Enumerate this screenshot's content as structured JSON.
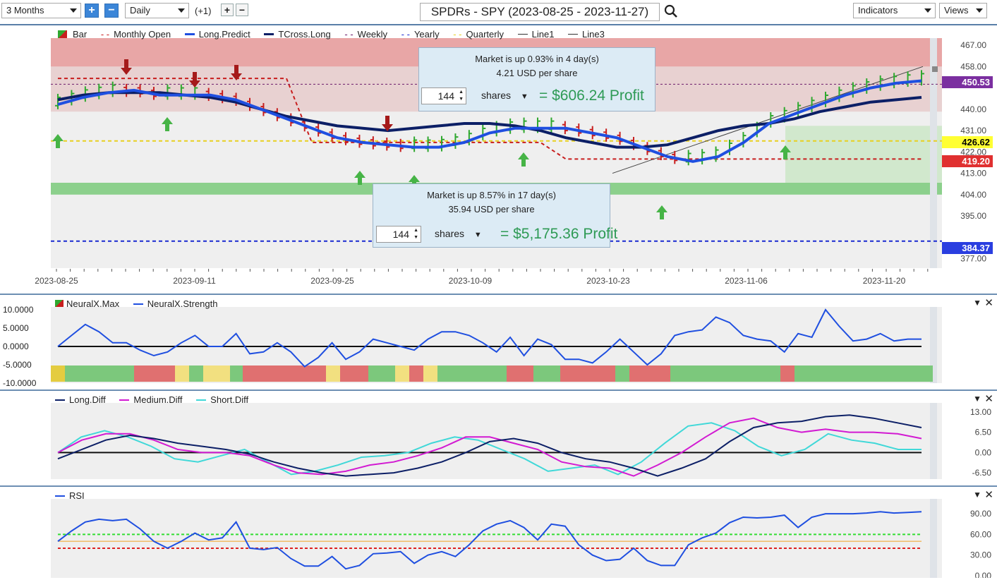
{
  "toolbar": {
    "period": "3 Months",
    "interval": "Daily",
    "offset": "(+1)",
    "title": "SPDRs - SPY (2023-08-25 - 2023-11-27)",
    "indicators": "Indicators",
    "views": "Views"
  },
  "legend_main": [
    "Bar",
    "Monthly Open",
    "Long.Predict",
    "TCross.Long",
    "Weekly",
    "Yearly",
    "Quarterly",
    "Line1",
    "Line3"
  ],
  "tooltip_top": {
    "line1": "Market is up 0.93% in 4 day(s)",
    "line2": "4.21 USD per share",
    "shares": "144",
    "shares_label": "shares",
    "profit": "= $606.24 Profit"
  },
  "tooltip_bottom": {
    "line1": "Market is up 8.57% in 17 day(s)",
    "line2": "35.94 USD per share",
    "shares": "144",
    "shares_label": "shares",
    "profit": "= $5,175.36 Profit"
  },
  "price_tags": {
    "t1": "450.53",
    "t2": "426.62",
    "t3": "419.20",
    "t4": "384.37"
  },
  "colors": {
    "up": "#2fa82f",
    "down": "#c81e1e",
    "long_predict": "#1f4fe0",
    "tcross": "#0c1f66",
    "tag_purple": "#7b2fa0",
    "tag_yellow": "#ffff33",
    "tag_red": "#e03030",
    "tag_blue": "#2a3ee0"
  },
  "chart_data": [
    {
      "type": "line",
      "title": "SPDRs - SPY (2023-08-25 - 2023-11-27)",
      "x_ticks": [
        "2023-08-25",
        "2023-09-11",
        "2023-09-25",
        "2023-10-09",
        "2023-10-23",
        "2023-11-06",
        "2023-11-20"
      ],
      "y_ticks": [
        467.0,
        458.0,
        440.0,
        431.0,
        422.0,
        413.0,
        404.0,
        395.0,
        377.0
      ],
      "ylim": [
        373,
        470
      ],
      "series": [
        {
          "name": "Long.Predict",
          "values": [
            442,
            445,
            447,
            448,
            446,
            446,
            446,
            444,
            440,
            436,
            432,
            428,
            426,
            425,
            424,
            424,
            426,
            430,
            432,
            432,
            432,
            430,
            428,
            424,
            420,
            418,
            420,
            426,
            434,
            438,
            442,
            446,
            449,
            451,
            452
          ]
        },
        {
          "name": "TCross.Long",
          "values": [
            444,
            446,
            447,
            447,
            447,
            446,
            445,
            443,
            440,
            437,
            435,
            433,
            432,
            431,
            432,
            433,
            434,
            434,
            433,
            431,
            428,
            426,
            424,
            424,
            425,
            428,
            431,
            433,
            434,
            436,
            439,
            441,
            443,
            444,
            445
          ]
        },
        {
          "name": "Monthly Open",
          "values": [
            453,
            453,
            453,
            453,
            453,
            453,
            453,
            453,
            453,
            453,
            426,
            426,
            426,
            426,
            426,
            426,
            426,
            426,
            426,
            426,
            419,
            419,
            419,
            419,
            419,
            419,
            419,
            419,
            419,
            419,
            419,
            419,
            419,
            419,
            419
          ]
        }
      ],
      "levels": {
        "Yearly": 384.37,
        "Quarterly": 426.62,
        "Line1": 450.53
      }
    },
    {
      "type": "line",
      "legend": [
        "NeuralX.Max",
        "NeuralX.Strength"
      ],
      "y_ticks": [
        10.0,
        5.0,
        0.0,
        -5.0,
        -10.0
      ],
      "ylim": [
        -10,
        10
      ],
      "series": [
        {
          "name": "NeuralX.Strength",
          "values": [
            0,
            3,
            6,
            4,
            1,
            1,
            -1,
            -2.5,
            -1.5,
            1,
            3,
            0,
            0,
            3.5,
            -2,
            -1.5,
            1,
            -1.5,
            -5.5,
            -3,
            1,
            -3.5,
            -1.5,
            2,
            1,
            0,
            -1,
            2,
            4,
            4,
            3,
            1,
            -1.5,
            2.5,
            -2.5,
            2,
            0.5,
            -3.5,
            -3.5,
            -4.5,
            -1.5,
            2,
            -1.5,
            -5,
            -2,
            3,
            4,
            4.5,
            8,
            6.5,
            3,
            2,
            1.5,
            -1.5,
            3.5,
            2.5,
            10,
            5.5,
            1.5,
            2,
            3.5,
            1.5,
            2,
            2
          ]
        }
      ]
    },
    {
      "type": "line",
      "legend": [
        "Long.Diff",
        "Medium.Diff",
        "Short.Diff"
      ],
      "y_ticks": [
        13.0,
        6.5,
        0.0,
        -6.5
      ],
      "ylim": [
        -8.5,
        15
      ],
      "series": [
        {
          "name": "Long.Diff",
          "values": [
            -2,
            1,
            4,
            5.5,
            4.5,
            3,
            2,
            1,
            -0.5,
            -3,
            -5,
            -6.5,
            -7.5,
            -7,
            -6.5,
            -5,
            -3,
            0,
            3.5,
            4.5,
            3,
            0,
            -2,
            -3,
            -5,
            -7.5,
            -5,
            -2,
            3.5,
            8,
            9.5,
            10,
            11.5,
            12,
            11,
            9.5,
            8
          ]
        },
        {
          "name": "Medium.Diff",
          "values": [
            0,
            4,
            6,
            6,
            4,
            1,
            0,
            0,
            -1,
            -4,
            -6.5,
            -7,
            -6,
            -4,
            -3,
            -1,
            1.5,
            5,
            5,
            3,
            1,
            -3,
            -4.5,
            -5,
            -7.5,
            -4,
            0,
            5,
            9.5,
            11,
            8,
            6.5,
            7.5,
            6.5,
            6.5,
            6,
            4.5
          ]
        },
        {
          "name": "Short.Diff",
          "values": [
            0,
            5,
            7,
            5,
            2,
            -2,
            -3,
            -1,
            1,
            -3,
            -7,
            -6,
            -4,
            -1.5,
            -1,
            0,
            3,
            5,
            4,
            1,
            -2,
            -6,
            -5,
            -4,
            -7,
            -3,
            3,
            8.5,
            9.5,
            7,
            2,
            -1,
            1,
            6,
            4,
            3,
            1,
            1
          ]
        }
      ]
    },
    {
      "type": "line",
      "legend": [
        "RSI"
      ],
      "y_ticks": [
        90.0,
        60.0,
        30.0,
        0.0
      ],
      "ylim": [
        0,
        100
      ],
      "series": [
        {
          "name": "RSI",
          "values": [
            50,
            65,
            78,
            82,
            80,
            82,
            68,
            50,
            40,
            50,
            62,
            52,
            55,
            78,
            40,
            38,
            41,
            25,
            14,
            14,
            28,
            10,
            15,
            32,
            33,
            35,
            18,
            30,
            35,
            28,
            45,
            65,
            75,
            80,
            70,
            52,
            75,
            72,
            45,
            30,
            22,
            24,
            40,
            22,
            15,
            15,
            45,
            55,
            62,
            77,
            85,
            84,
            85,
            88,
            70,
            85,
            90,
            90,
            90,
            91,
            93,
            91,
            92,
            93
          ]
        }
      ],
      "levels": [
        60,
        50,
        40
      ]
    }
  ]
}
